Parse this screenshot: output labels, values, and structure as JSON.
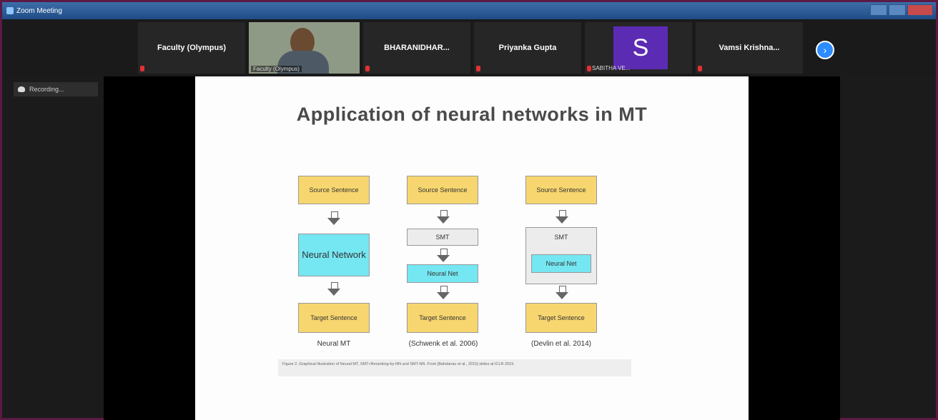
{
  "window": {
    "title": "Zoom Meeting"
  },
  "participants": [
    {
      "name": "Faculty (Olympus)"
    },
    {
      "name": "Faculty (Olympus)",
      "video": true
    },
    {
      "name": "BHARANIDHAR..."
    },
    {
      "name": "Priyanka Gupta"
    },
    {
      "name": "SABITHA VE...",
      "avatar_letter": "S",
      "avatar_color": "#5c2bb3"
    },
    {
      "name": "Vamsi Krishna..."
    }
  ],
  "recording": {
    "label": "Recording..."
  },
  "slide": {
    "title": "Application of neural networks in MT",
    "figure": {
      "col1": {
        "source": "Source Sentence",
        "middle": "Neural Network",
        "target": "Target Sentence",
        "label": "Neural MT"
      },
      "col2": {
        "source": "Source Sentence",
        "smt": "SMT",
        "nn": "Neural Net",
        "target": "Target Sentence",
        "label": "(Schwenk et al. 2006)"
      },
      "col3": {
        "source": "Source Sentence",
        "smt": "SMT",
        "nn": "Neural Net",
        "target": "Target Sentence",
        "label": "(Devlin et al. 2014)"
      },
      "caption": "Figure 2. Graphical illustration of Neural MT, SMT+Reranking-by-NN and SMT-NN. From [Bahdanau et al., 2015] slides at ICLR 2015."
    }
  },
  "colors": {
    "accent": "#2d8cff",
    "source_box": "#f7d66f",
    "nn_box": "#74e7f2"
  }
}
